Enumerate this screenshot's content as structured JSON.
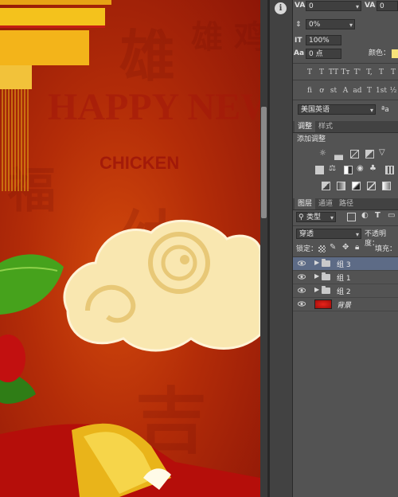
{
  "canvas": {
    "background_colors": {
      "center": "#d2490c",
      "edge": "#8e1607"
    },
    "poster_text": [
      "HAPPY NEW",
      "CHICKEN"
    ]
  },
  "character_panel": {
    "tracking_value": "0",
    "kerning_value": "0",
    "vertical_shift_value": "0%",
    "scale_value": "100%",
    "baseline_value": "0 点",
    "color_label": "颜色：",
    "color_swatch": "#f7e27a",
    "language_value": "美国英语",
    "aa_label": "a",
    "typo_buttons_row1": [
      "T",
      "T",
      "TT",
      "Tт",
      "T'",
      "T,",
      "T",
      "T"
    ],
    "typo_buttons_row2": [
      "fi",
      "ơ",
      "st",
      "A",
      "ad",
      "T",
      "1st",
      "½"
    ]
  },
  "adjustments_panel": {
    "tabs": [
      "调整",
      "样式"
    ],
    "header": "添加调整"
  },
  "layers_panel": {
    "tabs": [
      "图层",
      "通道",
      "路径"
    ],
    "filter_kind": "类型",
    "blend_mode": "穿透",
    "opacity_label": "不透明度：",
    "lock_label": "锁定：",
    "fill_label": "填充：",
    "layers": [
      {
        "name": "组 3",
        "type": "group",
        "selected": true
      },
      {
        "name": "组 1",
        "type": "group",
        "selected": false
      },
      {
        "name": "组 2",
        "type": "group",
        "selected": false
      },
      {
        "name": "背景",
        "type": "image",
        "selected": false
      }
    ]
  }
}
